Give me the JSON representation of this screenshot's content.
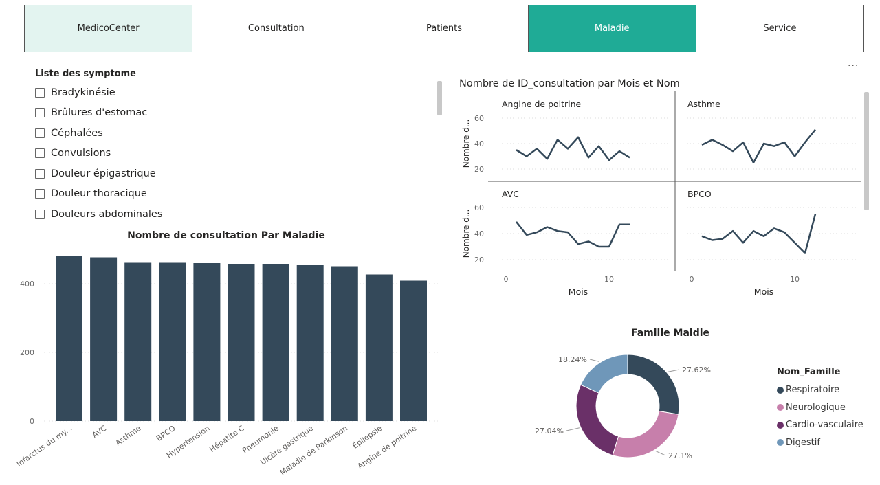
{
  "nav": {
    "items": [
      {
        "label": "MedicoCenter"
      },
      {
        "label": "Consultation"
      },
      {
        "label": "Patients"
      },
      {
        "label": "Maladie"
      },
      {
        "label": "Service"
      }
    ]
  },
  "more_label": "...",
  "symptoms": {
    "title": "Liste des symptome",
    "items": [
      "Bradykinésie",
      "Brûlures d'estomac",
      "Céphalées",
      "Convulsions",
      "Douleur épigastrique",
      "Douleur thoracique",
      "Douleurs abdominales"
    ]
  },
  "colors": {
    "accent": "#1fab96",
    "bar": "#34495a",
    "respiratoire": "#34495a",
    "neurologique": "#c77fab",
    "cardio": "#6a3068",
    "digestif": "#6f97b9"
  },
  "chart_data": [
    {
      "type": "bar",
      "title": "Nombre de consultation Par Maladie",
      "categories": [
        "Infarctus du my...",
        "AVC",
        "Asthme",
        "BPCO",
        "Hypertension",
        "Hépatite C",
        "Pneumonie",
        "Ulcère gastrique",
        "Maladie de Parkinson",
        "Épilepsie",
        "Angine de poitrine"
      ],
      "values": [
        482,
        477,
        461,
        461,
        460,
        458,
        457,
        454,
        451,
        427,
        409
      ],
      "yticks": [
        0,
        200,
        400
      ],
      "ylim": [
        0,
        500
      ],
      "grid": true
    },
    {
      "type": "line",
      "title": "Nombre de ID_consultation par Mois et Nom",
      "xlabel": "Mois",
      "ylabel": "Nombre d...",
      "xticks": [
        0,
        10
      ],
      "yticks": [
        20,
        40,
        60
      ],
      "xlim": [
        0,
        16
      ],
      "ylim": [
        15,
        65
      ],
      "panels": [
        {
          "name": "Angine de poitrine",
          "x": [
            1,
            2,
            3,
            4,
            5,
            6,
            7,
            8,
            9,
            10,
            11,
            12
          ],
          "y": [
            35,
            30,
            36,
            28,
            43,
            36,
            45,
            29,
            38,
            27,
            34,
            29
          ]
        },
        {
          "name": "Asthme",
          "x": [
            1,
            2,
            3,
            4,
            5,
            6,
            7,
            8,
            9,
            10,
            11,
            12
          ],
          "y": [
            39,
            43,
            39,
            34,
            41,
            25,
            40,
            38,
            41,
            30,
            41,
            51
          ]
        },
        {
          "name": "AVC",
          "x": [
            1,
            2,
            3,
            4,
            5,
            6,
            7,
            8,
            9,
            10,
            11,
            12
          ],
          "y": [
            49,
            39,
            41,
            45,
            42,
            41,
            32,
            34,
            30,
            30,
            47,
            47
          ]
        },
        {
          "name": "BPCO",
          "x": [
            1,
            2,
            3,
            4,
            5,
            6,
            7,
            8,
            9,
            10,
            11,
            12
          ],
          "y": [
            38,
            35,
            36,
            42,
            33,
            42,
            38,
            44,
            41,
            33,
            25,
            55
          ]
        }
      ]
    },
    {
      "type": "pie",
      "title": "Famille Maldie",
      "legend_title": "Nom_Famille",
      "slices": [
        {
          "name": "Respiratoire",
          "value": 27.62,
          "label": "27.62%"
        },
        {
          "name": "Neurologique",
          "value": 27.1,
          "label": "27.1%"
        },
        {
          "name": "Cardio-vasculaire",
          "value": 27.04,
          "label": "27.04%"
        },
        {
          "name": "Digestif",
          "value": 18.24,
          "label": "18.24%"
        }
      ]
    }
  ]
}
